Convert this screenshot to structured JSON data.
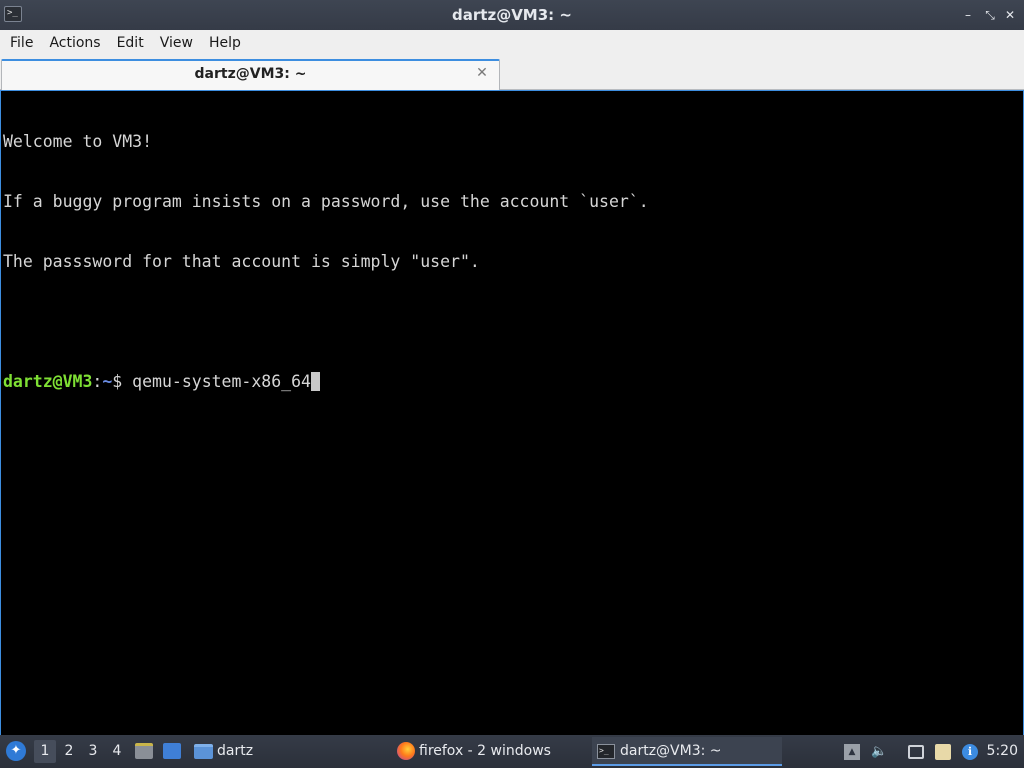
{
  "window": {
    "title": "dartz@VM3: ~",
    "icon": "terminal-icon",
    "icon_glyph": ">_",
    "buttons": {
      "minimize": "–",
      "maximize": "⤡",
      "close": "✕"
    }
  },
  "menubar": {
    "items": [
      "File",
      "Actions",
      "Edit",
      "View",
      "Help"
    ]
  },
  "tabs": [
    {
      "label": "dartz@VM3: ~",
      "close_glyph": "✕",
      "active": true
    }
  ],
  "terminal": {
    "lines": [
      "Welcome to VM3!",
      "If a buggy program insists on a password, use the account `user`.",
      "The passsword for that account is simply \"user\".",
      ""
    ],
    "prompt": {
      "user_host": "dartz@VM3",
      "colon": ":",
      "path": "~",
      "symbol": "$ ",
      "command": "qemu-system-x86_64"
    },
    "colors": {
      "background": "#000000",
      "text": "#d6d6d6",
      "user_host": "#7fe034",
      "path": "#6c8ee6"
    }
  },
  "taskbar": {
    "start_glyph": "✦",
    "desktops": [
      "1",
      "2",
      "3",
      "4"
    ],
    "active_desktop": "1",
    "quicklaunch": [
      "file-manager-icon",
      "show-desktop-icon"
    ],
    "folder_label": "dartz",
    "tasks": [
      {
        "label": "firefox - 2 windows",
        "icon": "firefox-icon",
        "active": false
      },
      {
        "label": "dartz@VM3: ~",
        "icon": "terminal-icon",
        "active": true
      }
    ],
    "tray": {
      "update_glyph": "▲",
      "volume_glyph": "🔈",
      "network_glyph": "▭",
      "clipboard_glyph": "📋",
      "notify_glyph": "ℹ"
    },
    "clock": "5:20"
  }
}
